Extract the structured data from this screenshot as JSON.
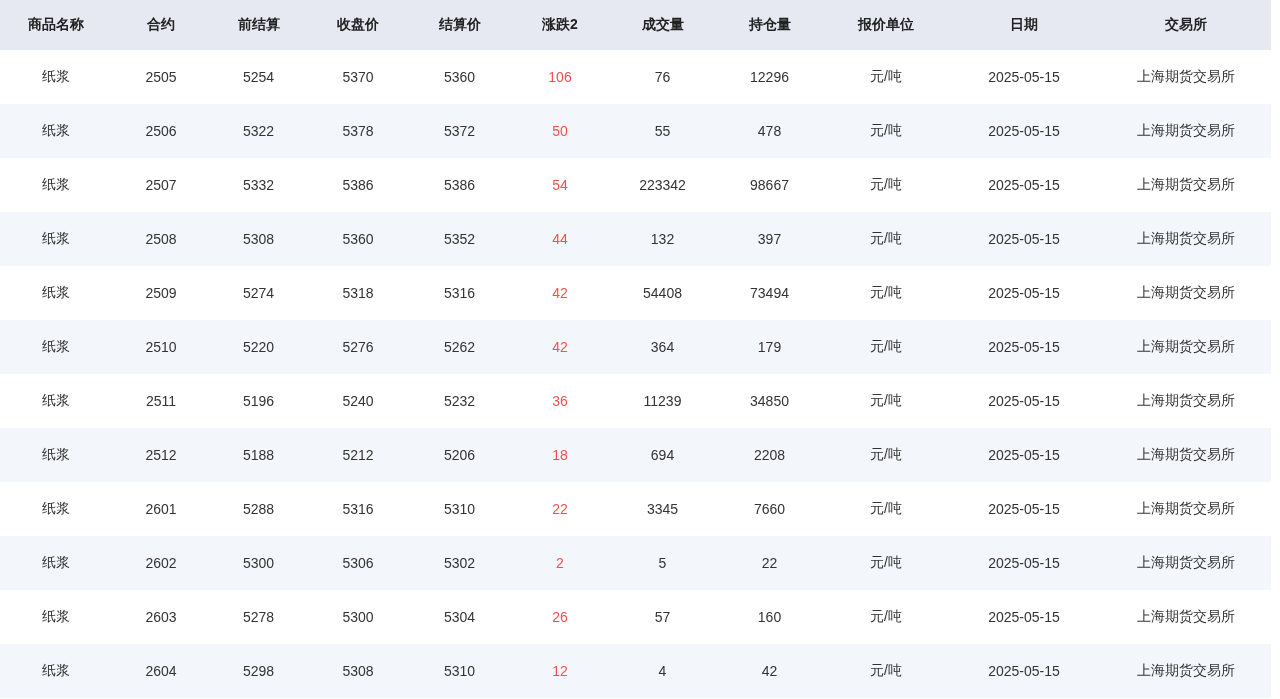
{
  "table": {
    "columns": [
      {
        "label": "商品名称",
        "kind": "text"
      },
      {
        "label": "合约",
        "kind": "text"
      },
      {
        "label": "前结算",
        "kind": "text"
      },
      {
        "label": "收盘价",
        "kind": "text"
      },
      {
        "label": "结算价",
        "kind": "text"
      },
      {
        "label": "涨跌2",
        "kind": "change"
      },
      {
        "label": "成交量",
        "kind": "text"
      },
      {
        "label": "持仓量",
        "kind": "text"
      },
      {
        "label": "报价单位",
        "kind": "text"
      },
      {
        "label": "日期",
        "kind": "text"
      },
      {
        "label": "交易所",
        "kind": "text"
      }
    ],
    "rows": [
      [
        "纸浆",
        "2505",
        "5254",
        "5370",
        "5360",
        "106",
        "76",
        "12296",
        "元/吨",
        "2025-05-15",
        "上海期货交易所"
      ],
      [
        "纸浆",
        "2506",
        "5322",
        "5378",
        "5372",
        "50",
        "55",
        "478",
        "元/吨",
        "2025-05-15",
        "上海期货交易所"
      ],
      [
        "纸浆",
        "2507",
        "5332",
        "5386",
        "5386",
        "54",
        "223342",
        "98667",
        "元/吨",
        "2025-05-15",
        "上海期货交易所"
      ],
      [
        "纸浆",
        "2508",
        "5308",
        "5360",
        "5352",
        "44",
        "132",
        "397",
        "元/吨",
        "2025-05-15",
        "上海期货交易所"
      ],
      [
        "纸浆",
        "2509",
        "5274",
        "5318",
        "5316",
        "42",
        "54408",
        "73494",
        "元/吨",
        "2025-05-15",
        "上海期货交易所"
      ],
      [
        "纸浆",
        "2510",
        "5220",
        "5276",
        "5262",
        "42",
        "364",
        "179",
        "元/吨",
        "2025-05-15",
        "上海期货交易所"
      ],
      [
        "纸浆",
        "2511",
        "5196",
        "5240",
        "5232",
        "36",
        "11239",
        "34850",
        "元/吨",
        "2025-05-15",
        "上海期货交易所"
      ],
      [
        "纸浆",
        "2512",
        "5188",
        "5212",
        "5206",
        "18",
        "694",
        "2208",
        "元/吨",
        "2025-05-15",
        "上海期货交易所"
      ],
      [
        "纸浆",
        "2601",
        "5288",
        "5316",
        "5310",
        "22",
        "3345",
        "7660",
        "元/吨",
        "2025-05-15",
        "上海期货交易所"
      ],
      [
        "纸浆",
        "2602",
        "5300",
        "5306",
        "5302",
        "2",
        "5",
        "22",
        "元/吨",
        "2025-05-15",
        "上海期货交易所"
      ],
      [
        "纸浆",
        "2603",
        "5278",
        "5300",
        "5304",
        "26",
        "57",
        "160",
        "元/吨",
        "2025-05-15",
        "上海期货交易所"
      ],
      [
        "纸浆",
        "2604",
        "5298",
        "5308",
        "5310",
        "12",
        "4",
        "42",
        "元/吨",
        "2025-05-15",
        "上海期货交易所"
      ]
    ]
  }
}
